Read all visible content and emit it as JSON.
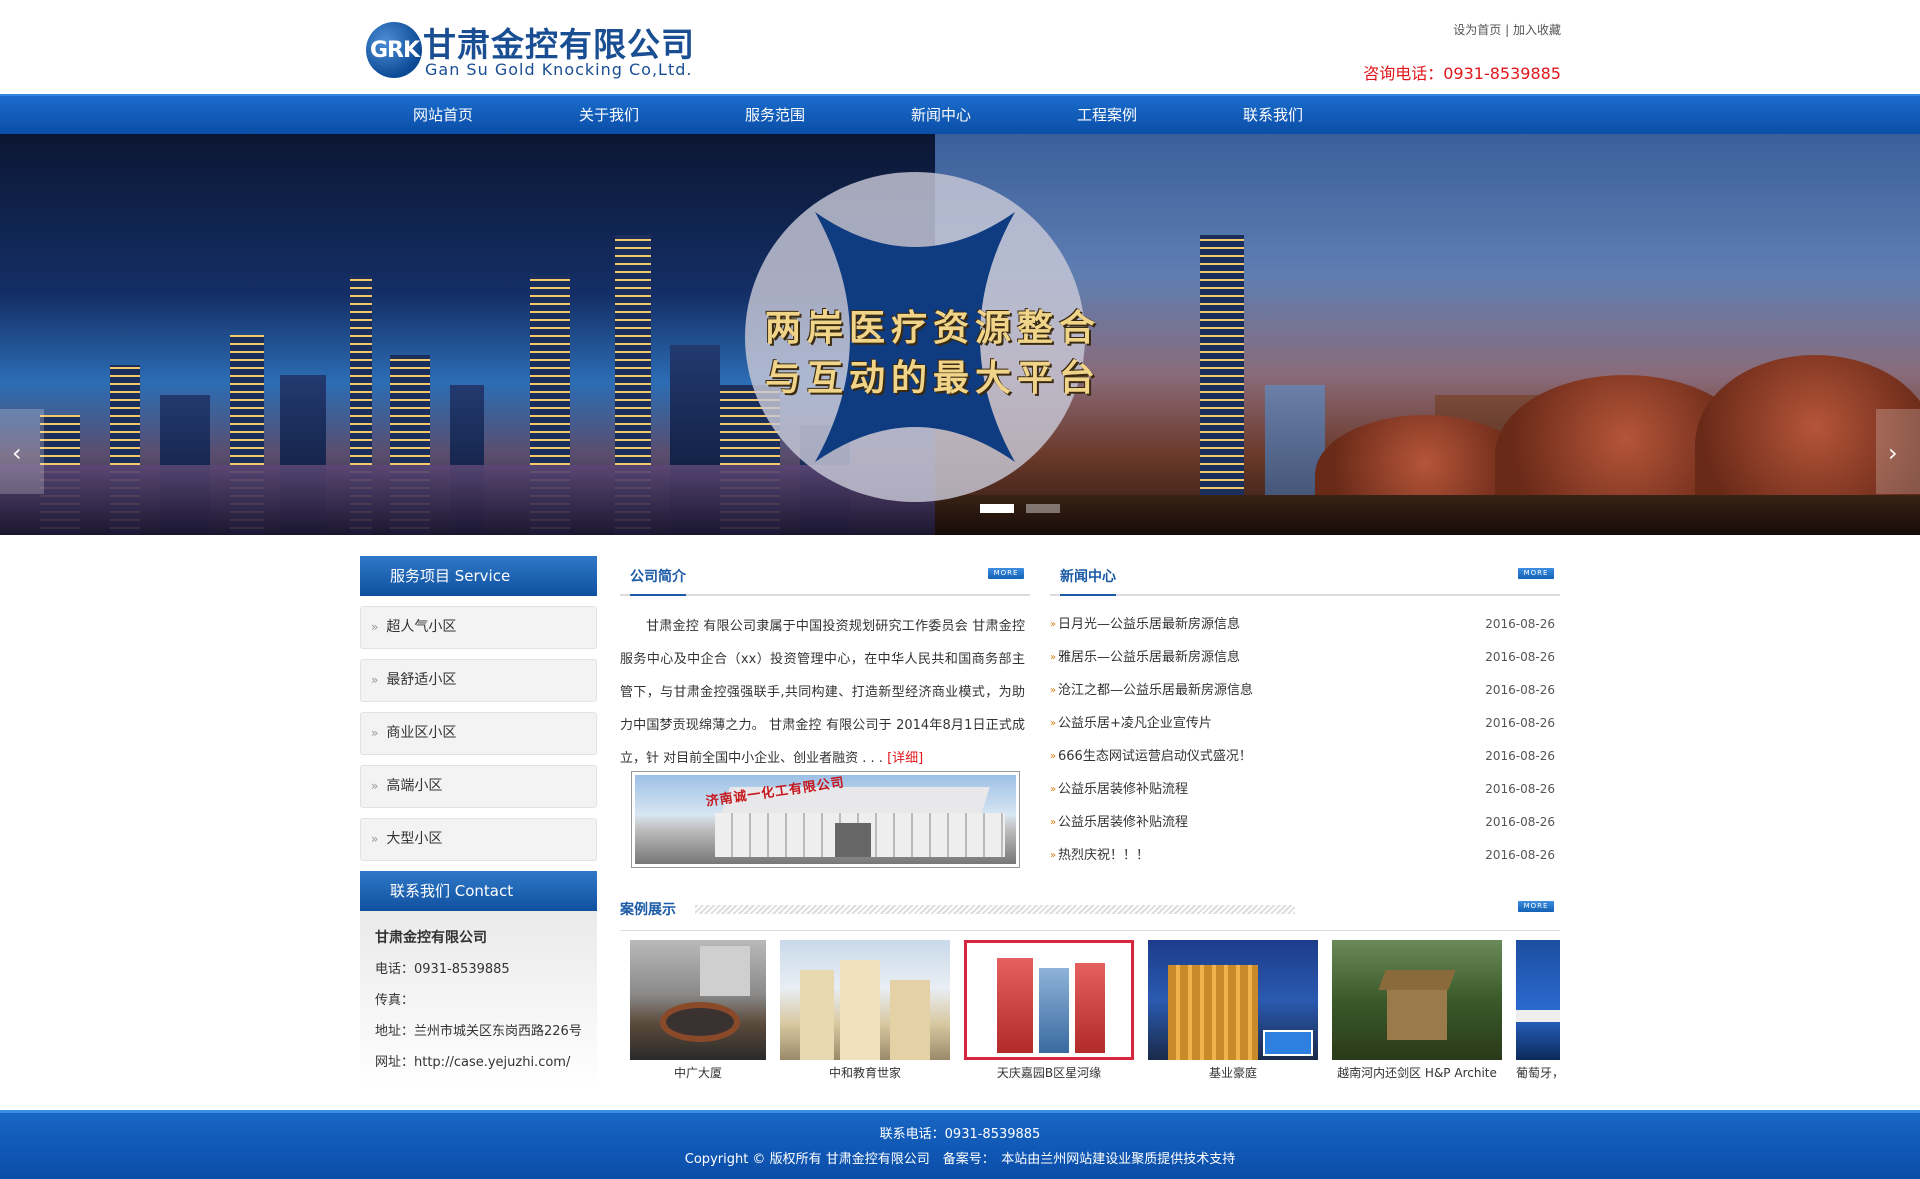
{
  "header": {
    "logo_mark": "GRK",
    "logo_cn": "甘肃金控有限公司",
    "logo_en": "Gan Su Gold Knocking Co,Ltd.",
    "set_home": "设为首页",
    "separator": "|",
    "add_fav": "加入收藏",
    "phone": "咨询电话：0931-8539885"
  },
  "nav": [
    "网站首页",
    "关于我们",
    "服务范围",
    "新闻中心",
    "工程案例",
    "联系我们"
  ],
  "banner": {
    "line1": "两岸医疗资源整合",
    "line2": "与互动的最大平台",
    "prev_arrow": "‹",
    "next_arrow": "›",
    "slides": 2,
    "active_slide": 1
  },
  "sidebar": {
    "service_title": "服务项目 Service",
    "items": [
      "超人气小区",
      "最舒适小区",
      "商业区小区",
      "高端小区",
      "大型小区"
    ],
    "contact_title": "联系我们 Contact",
    "company": "甘肃金控有限公司",
    "tel": "电话：0931-8539885",
    "fax": "传真：",
    "addr": "地址：兰州市城关区东岗西路226号",
    "web": "网址：http://case.yejuzhi.com/"
  },
  "about": {
    "title": "公司简介",
    "more": "MORE",
    "text": "甘肃金控 有限公司隶属于中国投资规划研究工作委员会 甘肃金控 服务中心及中企合（xx）投资管理中心，在中华人民共和国商务部主管下，与甘肃金控强强联手,共同构建、打造新型经济商业模式，为助力中国梦贡现绵薄之力。 甘肃金控 有限公司于 2014年8月1日正式成立，针 对目前全国中小企业、创业者融资 . . . ",
    "detail": "[详细]",
    "image_sign": "济南诚一化工有限公司"
  },
  "news": {
    "title": "新闻中心",
    "more": "MORE",
    "bullet": "»",
    "items": [
      {
        "title": "日月光—公益乐居最新房源信息",
        "date": "2016-08-26"
      },
      {
        "title": "雅居乐—公益乐居最新房源信息",
        "date": "2016-08-26"
      },
      {
        "title": "沧江之都—公益乐居最新房源信息",
        "date": "2016-08-26"
      },
      {
        "title": "公益乐居+凌凡企业宣传片",
        "date": "2016-08-26"
      },
      {
        "title": "666生态网试运营启动仪式盛况！",
        "date": "2016-08-26"
      },
      {
        "title": "公益乐居装修补贴流程",
        "date": "2016-08-26"
      },
      {
        "title": "公益乐居装修补贴流程",
        "date": "2016-08-26"
      },
      {
        "title": "热烈庆祝！！！",
        "date": "2016-08-26"
      }
    ]
  },
  "cases": {
    "title": "案例展示",
    "more": "MORE",
    "items": [
      "中广大厦",
      "中和教育世家",
      "天庆嘉园B区星河缘",
      "基业豪庭",
      "越南河内还剑区 H&P Archite",
      "葡萄牙，"
    ]
  },
  "sidebar_bullet": "»",
  "footer": {
    "contact": "联系电话：0931-8539885",
    "copyright": "Copyright © 版权所有 甘肃金控有限公司　备案号：　本站由兰州网站建设业聚质提供技术支持"
  },
  "colors": {
    "brand": "#1a5aa6",
    "nav": "#0a4ea7",
    "phone": "#e0161b"
  }
}
